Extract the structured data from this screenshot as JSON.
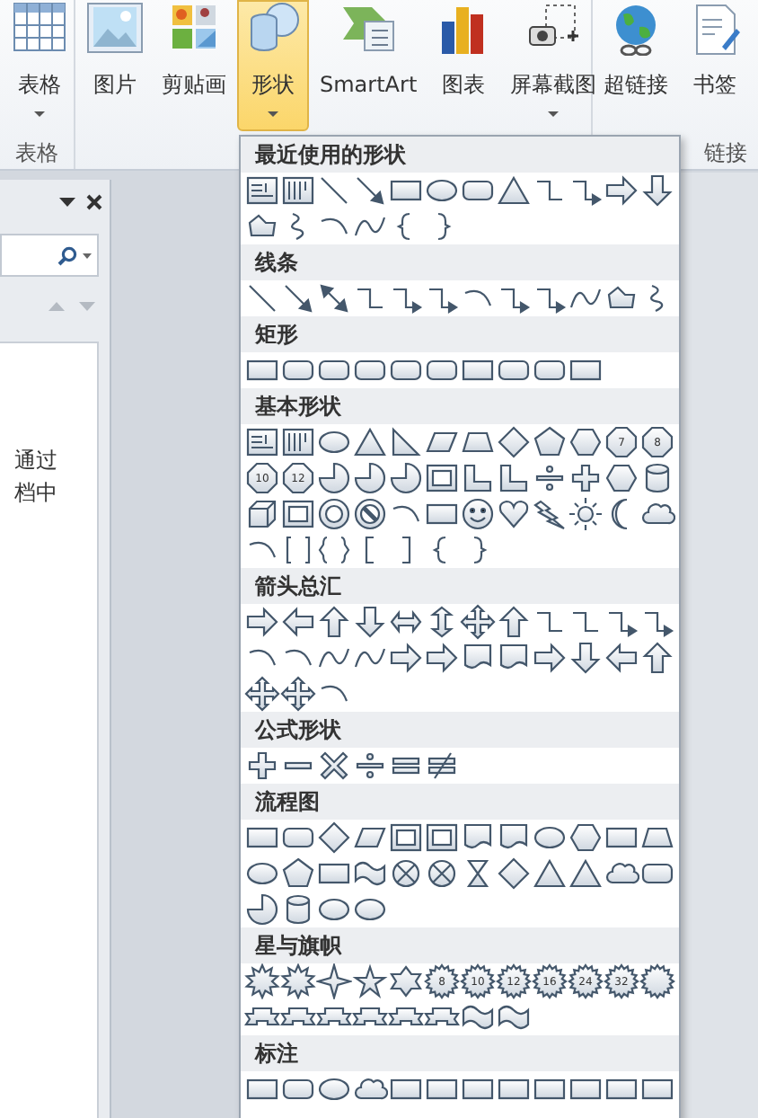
{
  "ribbon": {
    "groups": [
      {
        "label": "表格",
        "buttons": [
          {
            "label": "表格",
            "dropdown": true,
            "selected": false
          }
        ]
      },
      {
        "buttons": [
          {
            "label": "图片",
            "dropdown": false,
            "selected": false
          },
          {
            "label": "剪贴画",
            "dropdown": false,
            "selected": false
          },
          {
            "label": "形状",
            "dropdown": true,
            "selected": true
          },
          {
            "label": "SmartArt",
            "dropdown": false,
            "selected": false
          },
          {
            "label": "图表",
            "dropdown": false,
            "selected": false
          },
          {
            "label": "屏幕截图",
            "dropdown": true,
            "selected": false
          }
        ]
      },
      {
        "label": "链接",
        "buttons": [
          {
            "label": "超链接",
            "dropdown": false,
            "selected": false
          },
          {
            "label": "书签",
            "dropdown": false,
            "selected": false
          }
        ]
      }
    ]
  },
  "nav_pane": {
    "lines": [
      "通过",
      "档中"
    ]
  },
  "shapes_menu": {
    "sections": [
      {
        "title": "最近使用的形状"
      },
      {
        "title": "线条"
      },
      {
        "title": "矩形"
      },
      {
        "title": "基本形状",
        "shape_labels": [
          "7",
          "8",
          "10",
          "12"
        ]
      },
      {
        "title": "箭头总汇"
      },
      {
        "title": "公式形状"
      },
      {
        "title": "流程图"
      },
      {
        "title": "星与旗帜",
        "shape_labels": [
          "8",
          "10",
          "12",
          "16",
          "24",
          "32"
        ]
      },
      {
        "title": "标注"
      }
    ]
  }
}
